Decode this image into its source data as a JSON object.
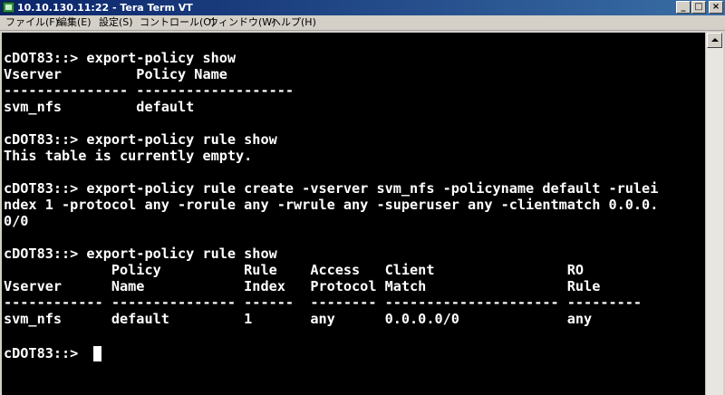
{
  "window": {
    "title": "10.10.130.11:22 - Tera Term VT",
    "minimize_label": "_",
    "maximize_label": "□",
    "close_label": "×"
  },
  "menu": {
    "items": [
      {
        "label": "ファイル(F)"
      },
      {
        "label": "編集(E)"
      },
      {
        "label": "設定(S)"
      },
      {
        "label": "コントロール(O)"
      },
      {
        "label": "ウィンドウ(W)"
      },
      {
        "label": "ヘルプ(H)"
      }
    ]
  },
  "terminal": {
    "lines": [
      "",
      "cDOT83::> export-policy show",
      "Vserver         Policy Name",
      "--------------- -------------------",
      "svm_nfs         default",
      "",
      "cDOT83::> export-policy rule show",
      "This table is currently empty.",
      "",
      "cDOT83::> export-policy rule create -vserver svm_nfs -policyname default -rulei",
      "ndex 1 -protocol any -rorule any -rwrule any -superuser any -clientmatch 0.0.0.",
      "0/0",
      "",
      "cDOT83::> export-policy rule show",
      "             Policy          Rule    Access   Client                RO",
      "Vserver      Name            Index   Protocol Match                 Rule",
      "------------ --------------- ------  -------- --------------------- ---------",
      "svm_nfs      default         1       any      0.0.0.0/0             any",
      "",
      "cDOT83::> "
    ]
  },
  "colors": {
    "terminal_background": "#000000",
    "terminal_foreground": "#ffffff",
    "titlebar_start": "#0a246a",
    "titlebar_end": "#3a6ea5"
  }
}
